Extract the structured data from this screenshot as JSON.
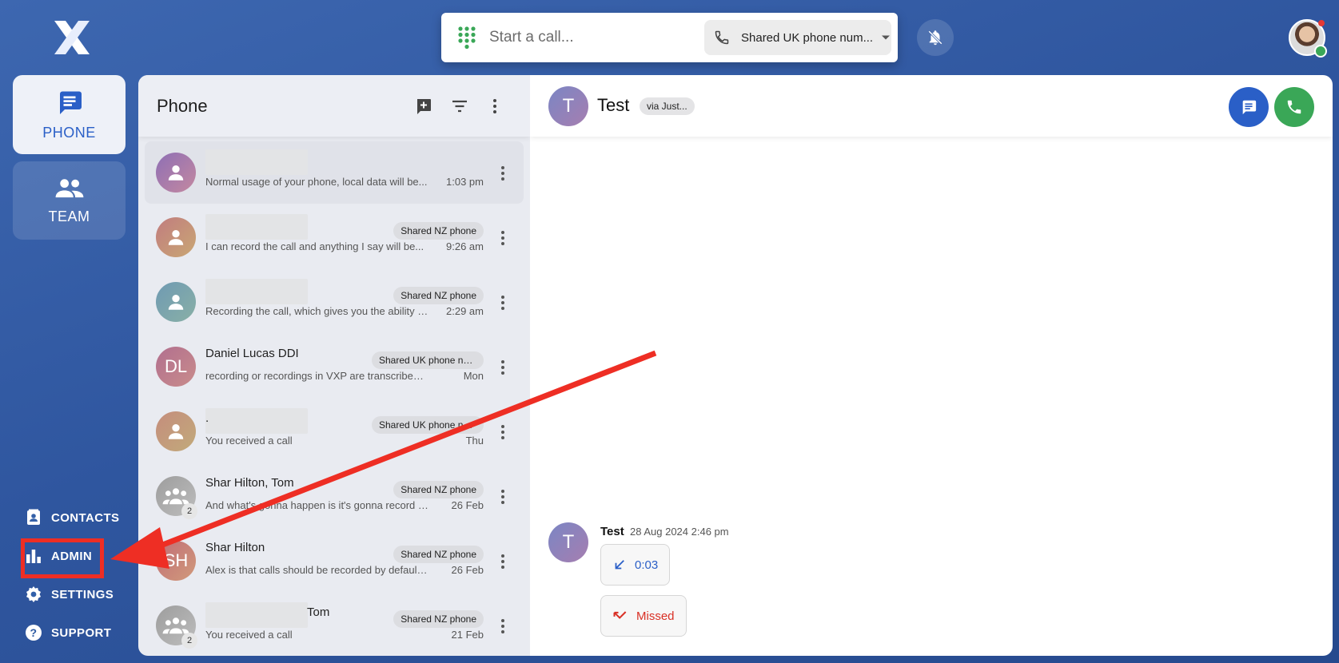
{
  "sidebar": {
    "nav": [
      {
        "label": "PHONE",
        "icon": "message-icon"
      },
      {
        "label": "TEAM",
        "icon": "people-icon"
      }
    ],
    "bottom": [
      {
        "label": "CONTACTS",
        "icon": "contacts-icon"
      },
      {
        "label": "ADMIN",
        "icon": "bar-chart-icon"
      },
      {
        "label": "SETTINGS",
        "icon": "gear-icon"
      },
      {
        "label": "SUPPORT",
        "icon": "help-icon"
      }
    ]
  },
  "callbar": {
    "placeholder": "Start a call...",
    "number_selected": "Shared UK phone num..."
  },
  "list": {
    "title": "Phone",
    "items": [
      {
        "name": "",
        "chip": "",
        "preview": "Normal usage of your phone, local data will be...",
        "time": "1:03 pm",
        "avatar": "person"
      },
      {
        "name": "",
        "chip": "Shared NZ phone",
        "preview": "I can record the call and anything I say will be...",
        "time": "9:26 am",
        "avatar": "person"
      },
      {
        "name": "",
        "chip": "Shared NZ phone",
        "preview": "Recording the call, which gives you the ability to...",
        "time": "2:29 am",
        "avatar": "person"
      },
      {
        "name": "Daniel Lucas DDI",
        "chip": "Shared UK phone nu...",
        "preview": "recording or recordings in VXP are transcribed and...",
        "time": "Mon",
        "avatar": "DL"
      },
      {
        "name": ".",
        "chip": "Shared UK phone nu...",
        "preview": "You received a call",
        "time": "Thu",
        "avatar": "person"
      },
      {
        "name": "Shar Hilton, Tom",
        "chip": "Shared NZ phone",
        "preview": "And what's gonna happen is it's gonna record the...",
        "time": "26 Feb",
        "avatar": "group",
        "count": "2"
      },
      {
        "name": "Shar Hilton",
        "chip": "Shared NZ phone",
        "preview": "Alex is that calls should be recorded by default. So...",
        "time": "26 Feb",
        "avatar": "SH"
      },
      {
        "name": "Tom",
        "chip": "Shared NZ phone",
        "preview": "You received a call",
        "time": "21 Feb",
        "avatar": "group",
        "count": "2"
      }
    ]
  },
  "conversation": {
    "avatar": "T",
    "title": "Test",
    "via": "via Just...",
    "message": {
      "author": "Test",
      "timestamp": "28 Aug 2024 2:46 pm",
      "calls": [
        {
          "label": "0:03",
          "color": "#2a5fc7"
        },
        {
          "label": "Missed",
          "color": "#d93025"
        }
      ]
    }
  },
  "colors": {
    "accent": "#2a5fc7",
    "call_green": "#3aa757",
    "annotation_red": "#ee2e24"
  }
}
